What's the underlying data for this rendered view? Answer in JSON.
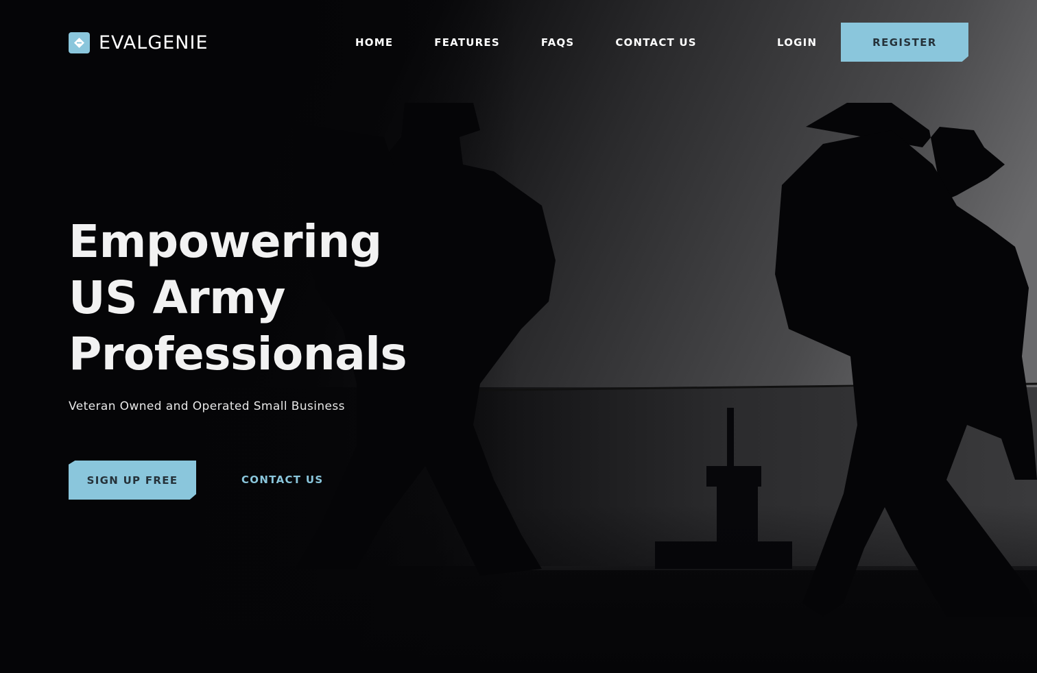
{
  "brand": {
    "name": "EVALGENIE",
    "logo_icon": "diamond-logo-icon",
    "accent_color": "#8ac6dc"
  },
  "nav": {
    "items": [
      {
        "label": "HOME"
      },
      {
        "label": "FEATURES"
      },
      {
        "label": "FAQS"
      },
      {
        "label": "CONTACT US"
      }
    ],
    "login_label": "LOGIN",
    "register_label": "REGISTER"
  },
  "hero": {
    "title_lines": [
      "Empowering",
      "US Army",
      "Professionals"
    ],
    "subtitle": "Veteran Owned and Operated Small Business",
    "primary_cta": "SIGN UP FREE",
    "secondary_cta": "CONTACT US",
    "background": "silhouettes of soldiers with backpacks walking past water (grayscale photo)"
  }
}
